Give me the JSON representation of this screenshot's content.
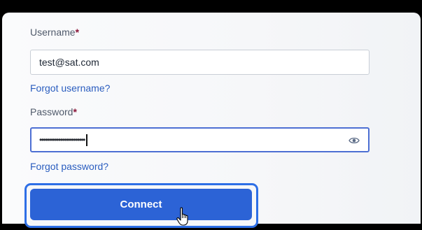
{
  "form": {
    "username_label": "Username",
    "username_required": "*",
    "username_value": "test@sat.com",
    "forgot_username": "Forgot username?",
    "password_label": "Password",
    "password_required": "*",
    "password_masked": "••••••••••••••••••••••••",
    "forgot_password": "Forgot password?",
    "connect_label": "Connect"
  },
  "icons": {
    "password_toggle": "eye-icon",
    "cursor": "hand-pointer-icon"
  },
  "colors": {
    "accent": "#2c63d6",
    "link": "#2a5dbf",
    "required": "#8a1538",
    "focus_ring": "#2e6fe6"
  }
}
